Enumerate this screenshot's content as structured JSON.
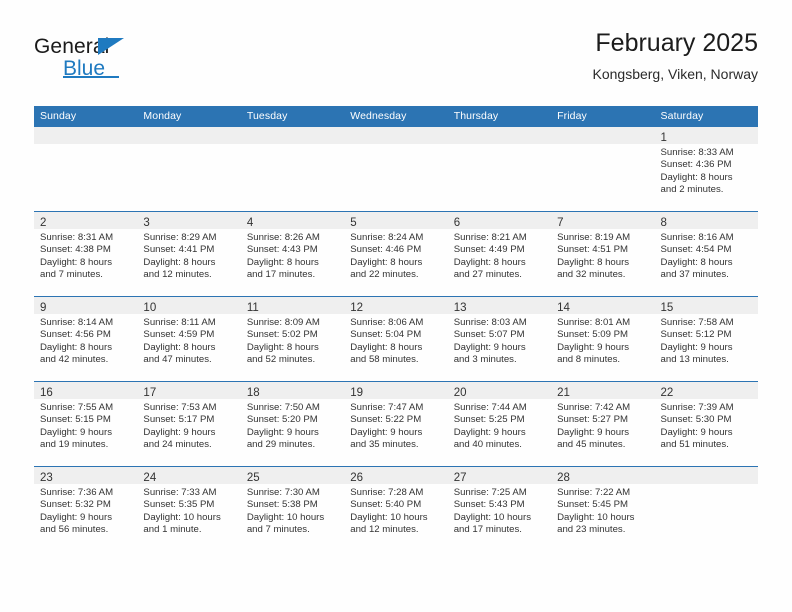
{
  "logo": {
    "word_one": "General",
    "word_two": "Blue",
    "brand_color": "#1f7ac0",
    "flag_icon": "triangle-flag-icon"
  },
  "header": {
    "title": "February 2025",
    "location": "Kongsberg, Viken, Norway"
  },
  "theme": {
    "header_bar": "#2c74b3",
    "daynum_band": "#efefef",
    "separator": "#2c74b3",
    "text": "#333333"
  },
  "weekdays": [
    "Sunday",
    "Monday",
    "Tuesday",
    "Wednesday",
    "Thursday",
    "Friday",
    "Saturday"
  ],
  "labels": {
    "sunrise": "Sunrise:",
    "sunset": "Sunset:",
    "daylight": "Daylight:"
  },
  "weeks": [
    [
      {
        "day": "",
        "empty": true
      },
      {
        "day": "",
        "empty": true
      },
      {
        "day": "",
        "empty": true
      },
      {
        "day": "",
        "empty": true
      },
      {
        "day": "",
        "empty": true
      },
      {
        "day": "",
        "empty": true
      },
      {
        "day": "1",
        "sunrise": "Sunrise: 8:33 AM",
        "sunset": "Sunset: 4:36 PM",
        "daylight_1": "Daylight: 8 hours",
        "daylight_2": "and 2 minutes."
      }
    ],
    [
      {
        "day": "2",
        "sunrise": "Sunrise: 8:31 AM",
        "sunset": "Sunset: 4:38 PM",
        "daylight_1": "Daylight: 8 hours",
        "daylight_2": "and 7 minutes."
      },
      {
        "day": "3",
        "sunrise": "Sunrise: 8:29 AM",
        "sunset": "Sunset: 4:41 PM",
        "daylight_1": "Daylight: 8 hours",
        "daylight_2": "and 12 minutes."
      },
      {
        "day": "4",
        "sunrise": "Sunrise: 8:26 AM",
        "sunset": "Sunset: 4:43 PM",
        "daylight_1": "Daylight: 8 hours",
        "daylight_2": "and 17 minutes."
      },
      {
        "day": "5",
        "sunrise": "Sunrise: 8:24 AM",
        "sunset": "Sunset: 4:46 PM",
        "daylight_1": "Daylight: 8 hours",
        "daylight_2": "and 22 minutes."
      },
      {
        "day": "6",
        "sunrise": "Sunrise: 8:21 AM",
        "sunset": "Sunset: 4:49 PM",
        "daylight_1": "Daylight: 8 hours",
        "daylight_2": "and 27 minutes."
      },
      {
        "day": "7",
        "sunrise": "Sunrise: 8:19 AM",
        "sunset": "Sunset: 4:51 PM",
        "daylight_1": "Daylight: 8 hours",
        "daylight_2": "and 32 minutes."
      },
      {
        "day": "8",
        "sunrise": "Sunrise: 8:16 AM",
        "sunset": "Sunset: 4:54 PM",
        "daylight_1": "Daylight: 8 hours",
        "daylight_2": "and 37 minutes."
      }
    ],
    [
      {
        "day": "9",
        "sunrise": "Sunrise: 8:14 AM",
        "sunset": "Sunset: 4:56 PM",
        "daylight_1": "Daylight: 8 hours",
        "daylight_2": "and 42 minutes."
      },
      {
        "day": "10",
        "sunrise": "Sunrise: 8:11 AM",
        "sunset": "Sunset: 4:59 PM",
        "daylight_1": "Daylight: 8 hours",
        "daylight_2": "and 47 minutes."
      },
      {
        "day": "11",
        "sunrise": "Sunrise: 8:09 AM",
        "sunset": "Sunset: 5:02 PM",
        "daylight_1": "Daylight: 8 hours",
        "daylight_2": "and 52 minutes."
      },
      {
        "day": "12",
        "sunrise": "Sunrise: 8:06 AM",
        "sunset": "Sunset: 5:04 PM",
        "daylight_1": "Daylight: 8 hours",
        "daylight_2": "and 58 minutes."
      },
      {
        "day": "13",
        "sunrise": "Sunrise: 8:03 AM",
        "sunset": "Sunset: 5:07 PM",
        "daylight_1": "Daylight: 9 hours",
        "daylight_2": "and 3 minutes."
      },
      {
        "day": "14",
        "sunrise": "Sunrise: 8:01 AM",
        "sunset": "Sunset: 5:09 PM",
        "daylight_1": "Daylight: 9 hours",
        "daylight_2": "and 8 minutes."
      },
      {
        "day": "15",
        "sunrise": "Sunrise: 7:58 AM",
        "sunset": "Sunset: 5:12 PM",
        "daylight_1": "Daylight: 9 hours",
        "daylight_2": "and 13 minutes."
      }
    ],
    [
      {
        "day": "16",
        "sunrise": "Sunrise: 7:55 AM",
        "sunset": "Sunset: 5:15 PM",
        "daylight_1": "Daylight: 9 hours",
        "daylight_2": "and 19 minutes."
      },
      {
        "day": "17",
        "sunrise": "Sunrise: 7:53 AM",
        "sunset": "Sunset: 5:17 PM",
        "daylight_1": "Daylight: 9 hours",
        "daylight_2": "and 24 minutes."
      },
      {
        "day": "18",
        "sunrise": "Sunrise: 7:50 AM",
        "sunset": "Sunset: 5:20 PM",
        "daylight_1": "Daylight: 9 hours",
        "daylight_2": "and 29 minutes."
      },
      {
        "day": "19",
        "sunrise": "Sunrise: 7:47 AM",
        "sunset": "Sunset: 5:22 PM",
        "daylight_1": "Daylight: 9 hours",
        "daylight_2": "and 35 minutes."
      },
      {
        "day": "20",
        "sunrise": "Sunrise: 7:44 AM",
        "sunset": "Sunset: 5:25 PM",
        "daylight_1": "Daylight: 9 hours",
        "daylight_2": "and 40 minutes."
      },
      {
        "day": "21",
        "sunrise": "Sunrise: 7:42 AM",
        "sunset": "Sunset: 5:27 PM",
        "daylight_1": "Daylight: 9 hours",
        "daylight_2": "and 45 minutes."
      },
      {
        "day": "22",
        "sunrise": "Sunrise: 7:39 AM",
        "sunset": "Sunset: 5:30 PM",
        "daylight_1": "Daylight: 9 hours",
        "daylight_2": "and 51 minutes."
      }
    ],
    [
      {
        "day": "23",
        "sunrise": "Sunrise: 7:36 AM",
        "sunset": "Sunset: 5:32 PM",
        "daylight_1": "Daylight: 9 hours",
        "daylight_2": "and 56 minutes."
      },
      {
        "day": "24",
        "sunrise": "Sunrise: 7:33 AM",
        "sunset": "Sunset: 5:35 PM",
        "daylight_1": "Daylight: 10 hours",
        "daylight_2": "and 1 minute."
      },
      {
        "day": "25",
        "sunrise": "Sunrise: 7:30 AM",
        "sunset": "Sunset: 5:38 PM",
        "daylight_1": "Daylight: 10 hours",
        "daylight_2": "and 7 minutes."
      },
      {
        "day": "26",
        "sunrise": "Sunrise: 7:28 AM",
        "sunset": "Sunset: 5:40 PM",
        "daylight_1": "Daylight: 10 hours",
        "daylight_2": "and 12 minutes."
      },
      {
        "day": "27",
        "sunrise": "Sunrise: 7:25 AM",
        "sunset": "Sunset: 5:43 PM",
        "daylight_1": "Daylight: 10 hours",
        "daylight_2": "and 17 minutes."
      },
      {
        "day": "28",
        "sunrise": "Sunrise: 7:22 AM",
        "sunset": "Sunset: 5:45 PM",
        "daylight_1": "Daylight: 10 hours",
        "daylight_2": "and 23 minutes."
      },
      {
        "day": "",
        "empty": true
      }
    ]
  ]
}
